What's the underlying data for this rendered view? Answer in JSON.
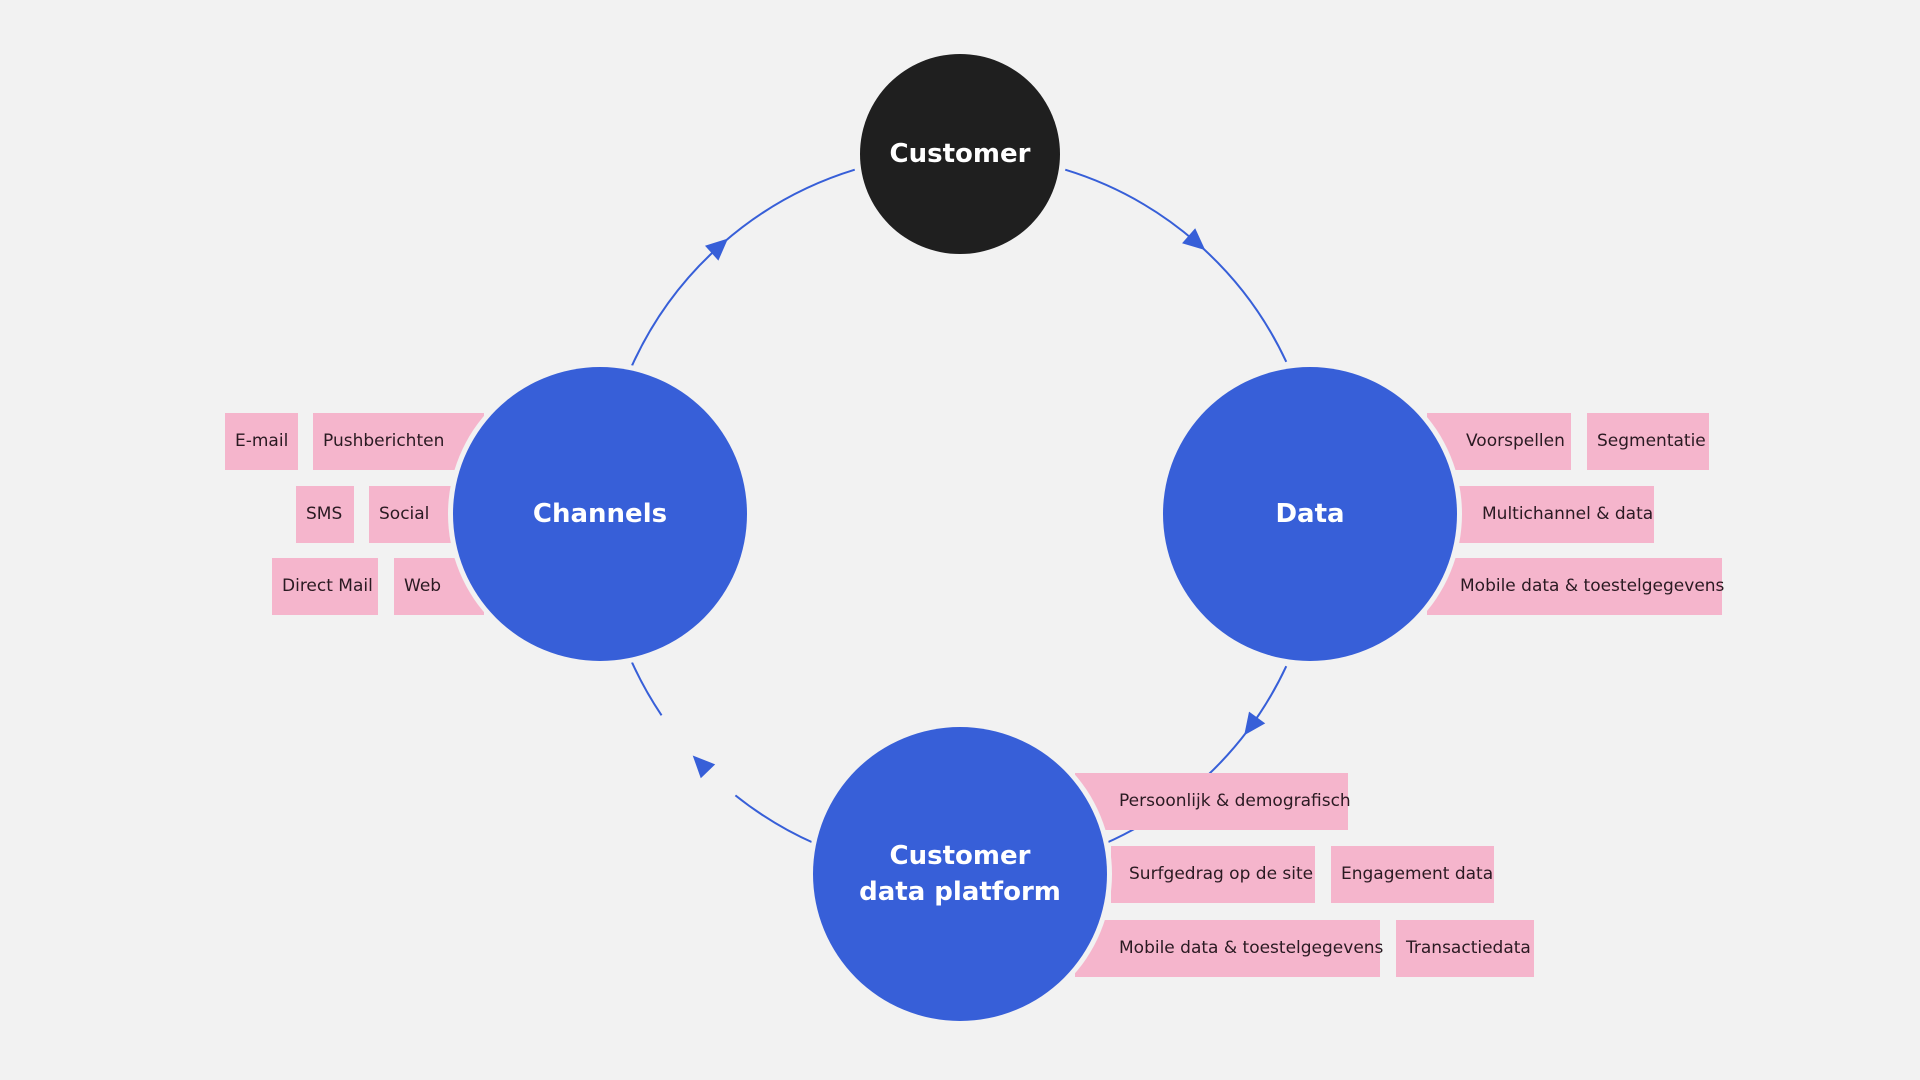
{
  "colors": {
    "background": "#f2f2f2",
    "node": "#375fd8",
    "customer_node": "#1f1f1f",
    "tag": "#f5b5cc",
    "arrow": "#375fd8"
  },
  "nodes": {
    "customer": "Customer",
    "channels": "Channels",
    "data": "Data",
    "cdp_line1": "Customer",
    "cdp_line2": "data platform"
  },
  "channels_tags": [
    "E-mail",
    "Pushberichten",
    "SMS",
    "Social",
    "Direct Mail",
    "Web"
  ],
  "data_tags": [
    "Voorspellen",
    "Segmentatie",
    "Multichannel & data",
    "Mobile data & toestelgegevens"
  ],
  "cdp_tags": [
    "Persoonlijk & demografisch",
    "Surfgedrag op de site",
    "Engagement data",
    "Mobile data & toestelgegevens",
    "Transactiedata"
  ],
  "flow_direction": "clockwise"
}
